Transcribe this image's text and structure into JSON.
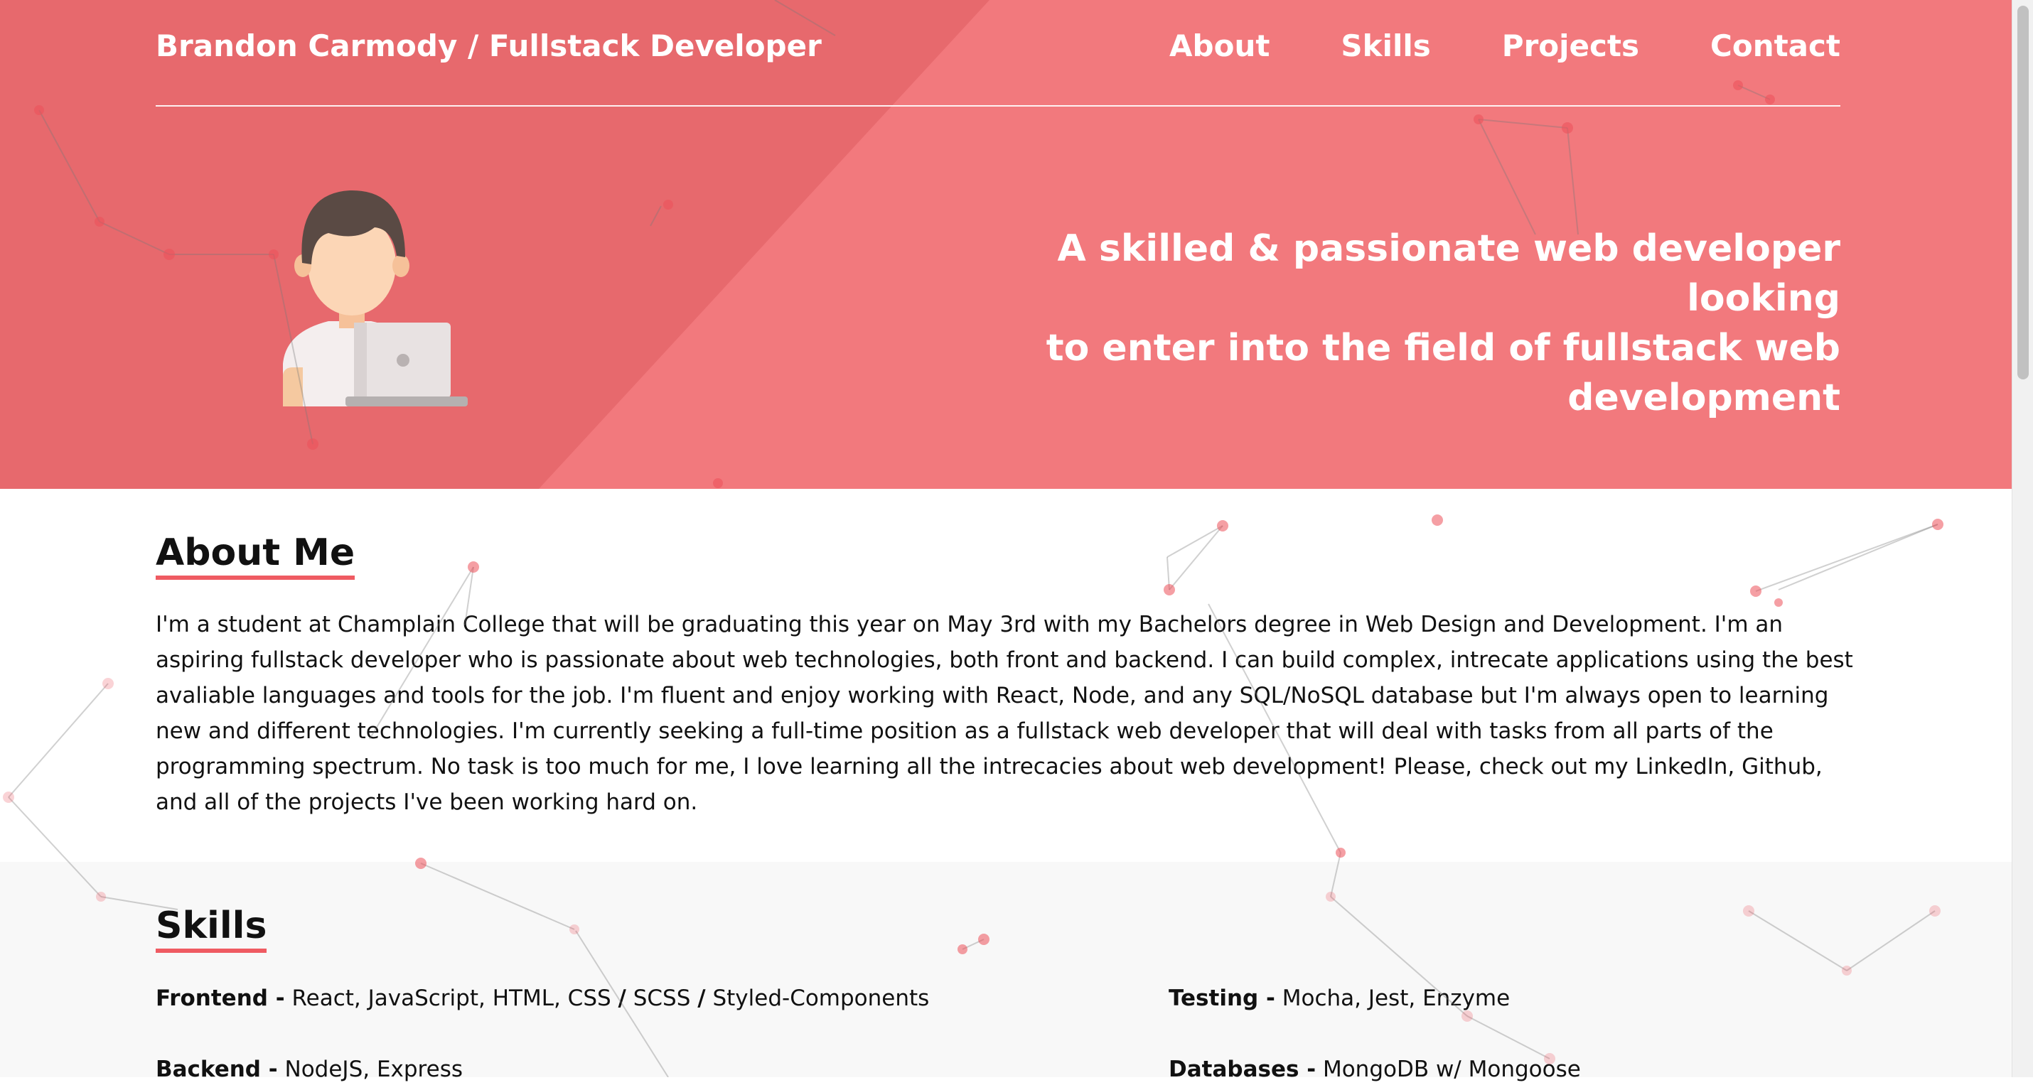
{
  "header": {
    "brand": "Brandon Carmody / Fullstack Developer",
    "nav": [
      "About",
      "Skills",
      "Projects",
      "Contact"
    ]
  },
  "hero": {
    "tagline_line1": "A skilled & passionate web developer looking",
    "tagline_line2": "to enter into the field of fullstack web",
    "tagline_line3": "development",
    "avatar_icon": "developer-avatar-icon"
  },
  "about": {
    "title": "About Me",
    "text": "I'm a student at Champlain College that will be graduating this year on May 3rd with my Bachelors degree in Web Design and Development. I'm an aspiring fullstack developer who is passionate about web technologies, both front and backend. I can build complex, intrecate applications using the best avaliable languages and tools for the job. I'm fluent and enjoy working with React, Node, and any SQL/NoSQL database but I'm always open to learning new and different technologies. I'm currently seeking a full-time position as a fullstack web developer that will deal with tasks from all parts of the programming spectrum. No task is too much for me, I love learning all the intrecacies about web development! Please, check out my LinkedIn, Github, and all of the projects I've been working hard on."
  },
  "skills": {
    "title": "Skills",
    "items": [
      {
        "label": "Frontend -",
        "value_a": "React, JavaScript, HTML, CSS",
        "sep1": "/",
        "value_b": "SCSS",
        "sep2": "/",
        "value_c": "Styled-Components"
      },
      {
        "label": "Testing -",
        "value": "Mocha, Jest, Enzyme"
      },
      {
        "label": "Backend -",
        "value": "NodeJS, Express"
      },
      {
        "label": "Databases -",
        "value": "MongoDB w/ Mongoose"
      }
    ]
  },
  "colors": {
    "hero_bg": "#f2797d",
    "hero_dark": "#e7696d",
    "accent": "#ef5b62"
  }
}
